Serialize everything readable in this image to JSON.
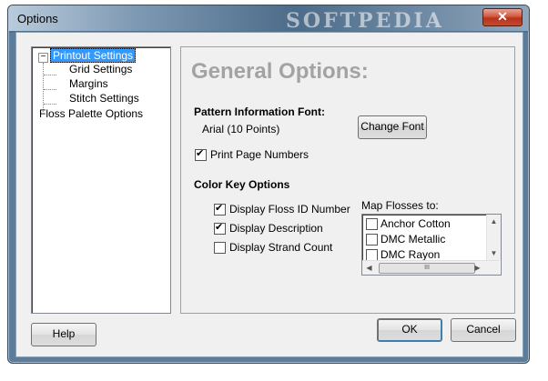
{
  "window": {
    "title": "Options",
    "watermark": "SOFTPEDIA",
    "close_glyph": "✕"
  },
  "tree": {
    "expander": "−",
    "items": [
      {
        "label": "Printout Settings",
        "selected": true
      },
      {
        "label": "Grid Settings"
      },
      {
        "label": "Margins"
      },
      {
        "label": "Stitch Settings"
      },
      {
        "label": "Floss Palette Options"
      }
    ]
  },
  "panel": {
    "heading": "General Options:",
    "font_section": {
      "label": "Pattern Information Font:",
      "value": "Arial  (10 Points)",
      "change_font_label": "Change Font"
    },
    "print_page_numbers": {
      "label": "Print Page Numbers",
      "checked": true
    },
    "color_key": {
      "label": "Color Key Options",
      "options": [
        {
          "label": "Display Floss ID Number",
          "checked": true
        },
        {
          "label": "Display Description",
          "checked": true
        },
        {
          "label": "Display Strand Count",
          "checked": false
        }
      ]
    },
    "map_flosses": {
      "label": "Map Flosses to:",
      "items": [
        {
          "label": "Anchor Cotton",
          "checked": false
        },
        {
          "label": "DMC Metallic",
          "checked": false
        },
        {
          "label": "DMC Rayon",
          "checked": false
        }
      ],
      "thumb_grip": "III"
    }
  },
  "buttons": {
    "help": "Help",
    "ok": "OK",
    "cancel": "Cancel"
  }
}
